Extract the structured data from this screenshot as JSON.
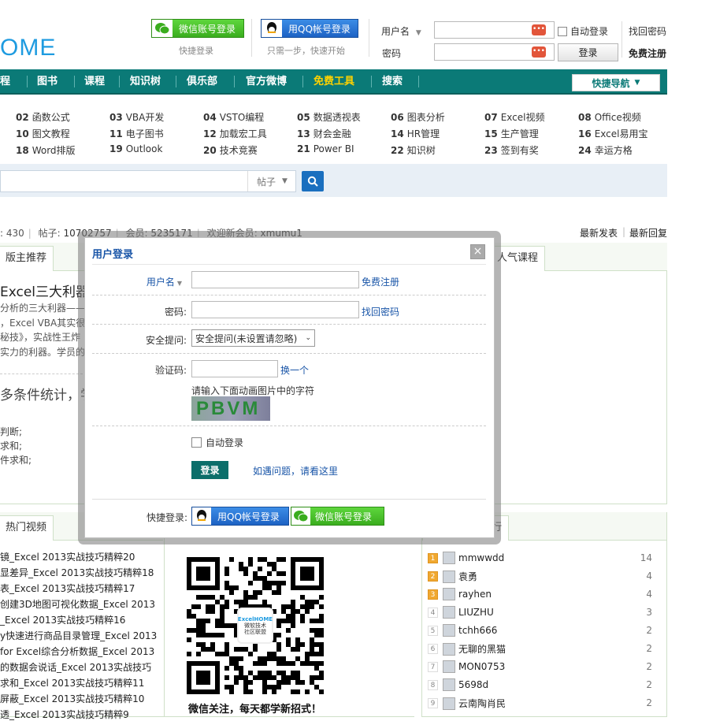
{
  "header": {
    "logo_text": "OME",
    "wechat_login_label": "微信账号登录",
    "wechat_sub": "快捷登录",
    "qq_login_label": "用QQ帐号登录",
    "qq_sub": "只需一步，快速开始",
    "username_label": "用户名",
    "password_label": "密码",
    "auto_login_label": "自动登录",
    "find_password": "找回密码",
    "login_button": "登录",
    "register": "免费注册"
  },
  "nav": {
    "items": [
      "程",
      "图书",
      "课程",
      "知识树",
      "俱乐部",
      "官方微博",
      "免费工具",
      "搜索"
    ],
    "highlight_color": "#ffd200",
    "quick_nav": "快捷导航"
  },
  "categories": [
    [
      "02",
      "函数公式"
    ],
    [
      "03",
      "VBA开发"
    ],
    [
      "04",
      "VSTO编程"
    ],
    [
      "05",
      "数据透视表"
    ],
    [
      "06",
      "图表分析"
    ],
    [
      "07",
      "Excel视频"
    ],
    [
      "08",
      "Office视频"
    ],
    [
      "10",
      "图文教程"
    ],
    [
      "11",
      "电子图书"
    ],
    [
      "12",
      "加载宏工具"
    ],
    [
      "13",
      "财会金融"
    ],
    [
      "14",
      "HR管理"
    ],
    [
      "15",
      "生产管理"
    ],
    [
      "16",
      "Excel易用宝"
    ],
    [
      "18",
      "Word排版"
    ],
    [
      "19",
      "Outlook"
    ],
    [
      "20",
      "技术竞赛"
    ],
    [
      "21",
      "Power BI"
    ],
    [
      "22",
      "知识树"
    ],
    [
      "23",
      "签到有奖"
    ],
    [
      "24",
      "幸运方格"
    ]
  ],
  "search": {
    "scope": "帖子"
  },
  "stats": {
    "today": ": 430",
    "posts_label": "帖子",
    "posts": "10702757",
    "members_label": "会员",
    "members": "5235171",
    "welcome_label": "欢迎新会员",
    "newest_member": "xmumu1",
    "latest_posts": "最新发表",
    "latest_replies": "最新回复"
  },
  "left_panel": {
    "tab": "版主推荐",
    "headline": "Excel三大利器",
    "lines": [
      "分析的三大利器——",
      "，Excel VBA其实很",
      "秘技》，实战性王炸",
      "实力的利器。学员的"
    ],
    "headline2": "多条件统计，学",
    "items": [
      "判断;",
      "求和;",
      "件求和;"
    ]
  },
  "right_tab": "人气课程",
  "video_tab": "热门视频",
  "videos": [
    "镜_Excel 2013实战技巧精粹20",
    "显差异_Excel 2013实战技巧精粹18",
    "表_Excel 2013实战技巧精粹17",
    "创建3D地图可视化数据_Excel 2013",
    "_Excel 2013实战技巧精粹16",
    "y快速进行商品目录管理_Excel 2013",
    "for Excel综合分析数据_Excel 2013",
    "的数据会说话_Excel 2013实战技巧",
    "求和_Excel 2013实战技巧精粹11",
    "屏蔽_Excel 2013实战技巧精粹10",
    "透_Excel 2013实战技巧精粹9"
  ],
  "qr": {
    "caption": "微信关注，每天都学新招式！",
    "center_text": "微软技术社区联盟"
  },
  "rank_tab": "行",
  "ranking": [
    {
      "rank": "1",
      "name": "mmwwdd",
      "count": "14"
    },
    {
      "rank": "2",
      "name": "袁勇",
      "count": "4"
    },
    {
      "rank": "3",
      "name": "rayhen",
      "count": "4"
    },
    {
      "rank": "4",
      "name": "LIUZHU",
      "count": "3"
    },
    {
      "rank": "5",
      "name": "tchh666",
      "count": "2"
    },
    {
      "rank": "6",
      "name": "无聊的黑猫",
      "count": "2"
    },
    {
      "rank": "7",
      "name": "MON0753",
      "count": "2"
    },
    {
      "rank": "8",
      "name": "5698d",
      "count": "2"
    },
    {
      "rank": "9",
      "name": "云南陶肖民",
      "count": "2"
    }
  ],
  "modal": {
    "title": "用户登录",
    "close": "×",
    "username_label": "用户名",
    "register": "免费注册",
    "password_label": "密码:",
    "find_password": "找回密码",
    "question_label": "安全提问:",
    "question_value": "安全提问(未设置请忽略)",
    "captcha_label": "验证码:",
    "refresh": "换一个",
    "captcha_hint": "请输入下面动画图片中的字符",
    "captcha_text": "PBVM",
    "auto_login": "自动登录",
    "login_button": "登录",
    "help_link": "如遇问题，请看这里",
    "quick_login_label": "快捷登录:",
    "qq_label": "用QQ帐号登录",
    "wechat_label": "微信账号登录"
  }
}
